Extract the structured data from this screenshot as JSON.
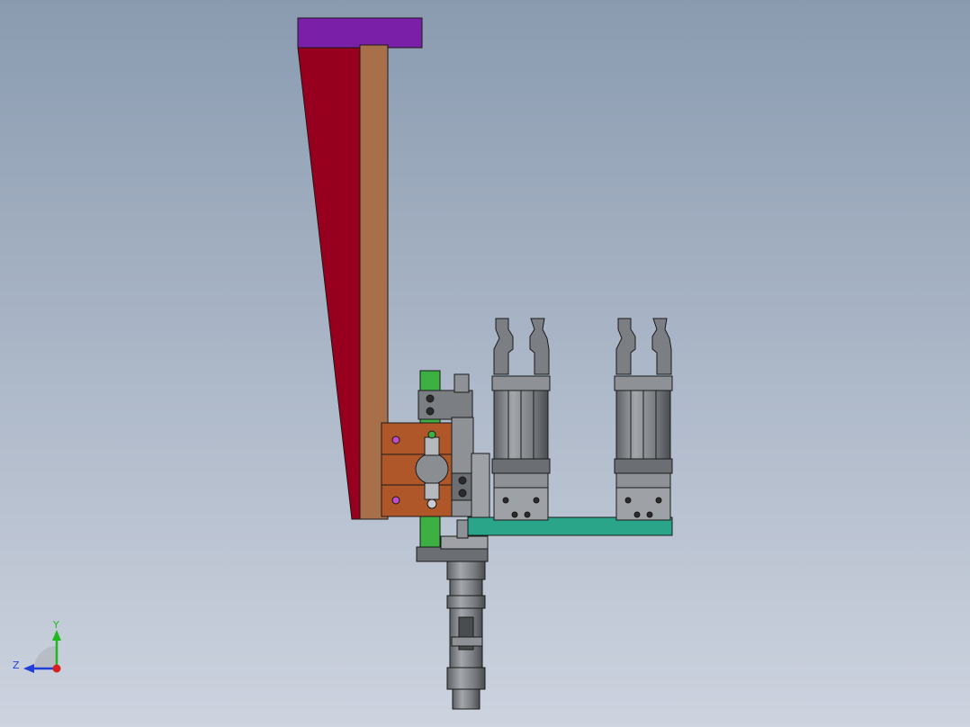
{
  "viewport": {
    "background_top": "#8a9bb0",
    "background_bottom": "#cdd3df"
  },
  "colors": {
    "top_plate": "#7a1fa8",
    "wedge": "#96001e",
    "post": "#a8704a",
    "green_rail": "#3cb043",
    "copper_block": "#b0572a",
    "teal_plate": "#2aa58a",
    "metal": "#7b7f84",
    "metal_light": "#a3a7ab",
    "metal_dark": "#4a4d50",
    "edge": "#1a1a1a"
  },
  "triad": {
    "y_label": "Y",
    "z_label": "Z",
    "y_color": "#1fb81f",
    "z_color": "#1f3fd8",
    "x_color": "#d81f1f"
  },
  "icons": [
    "coordinate-triad-icon"
  ]
}
